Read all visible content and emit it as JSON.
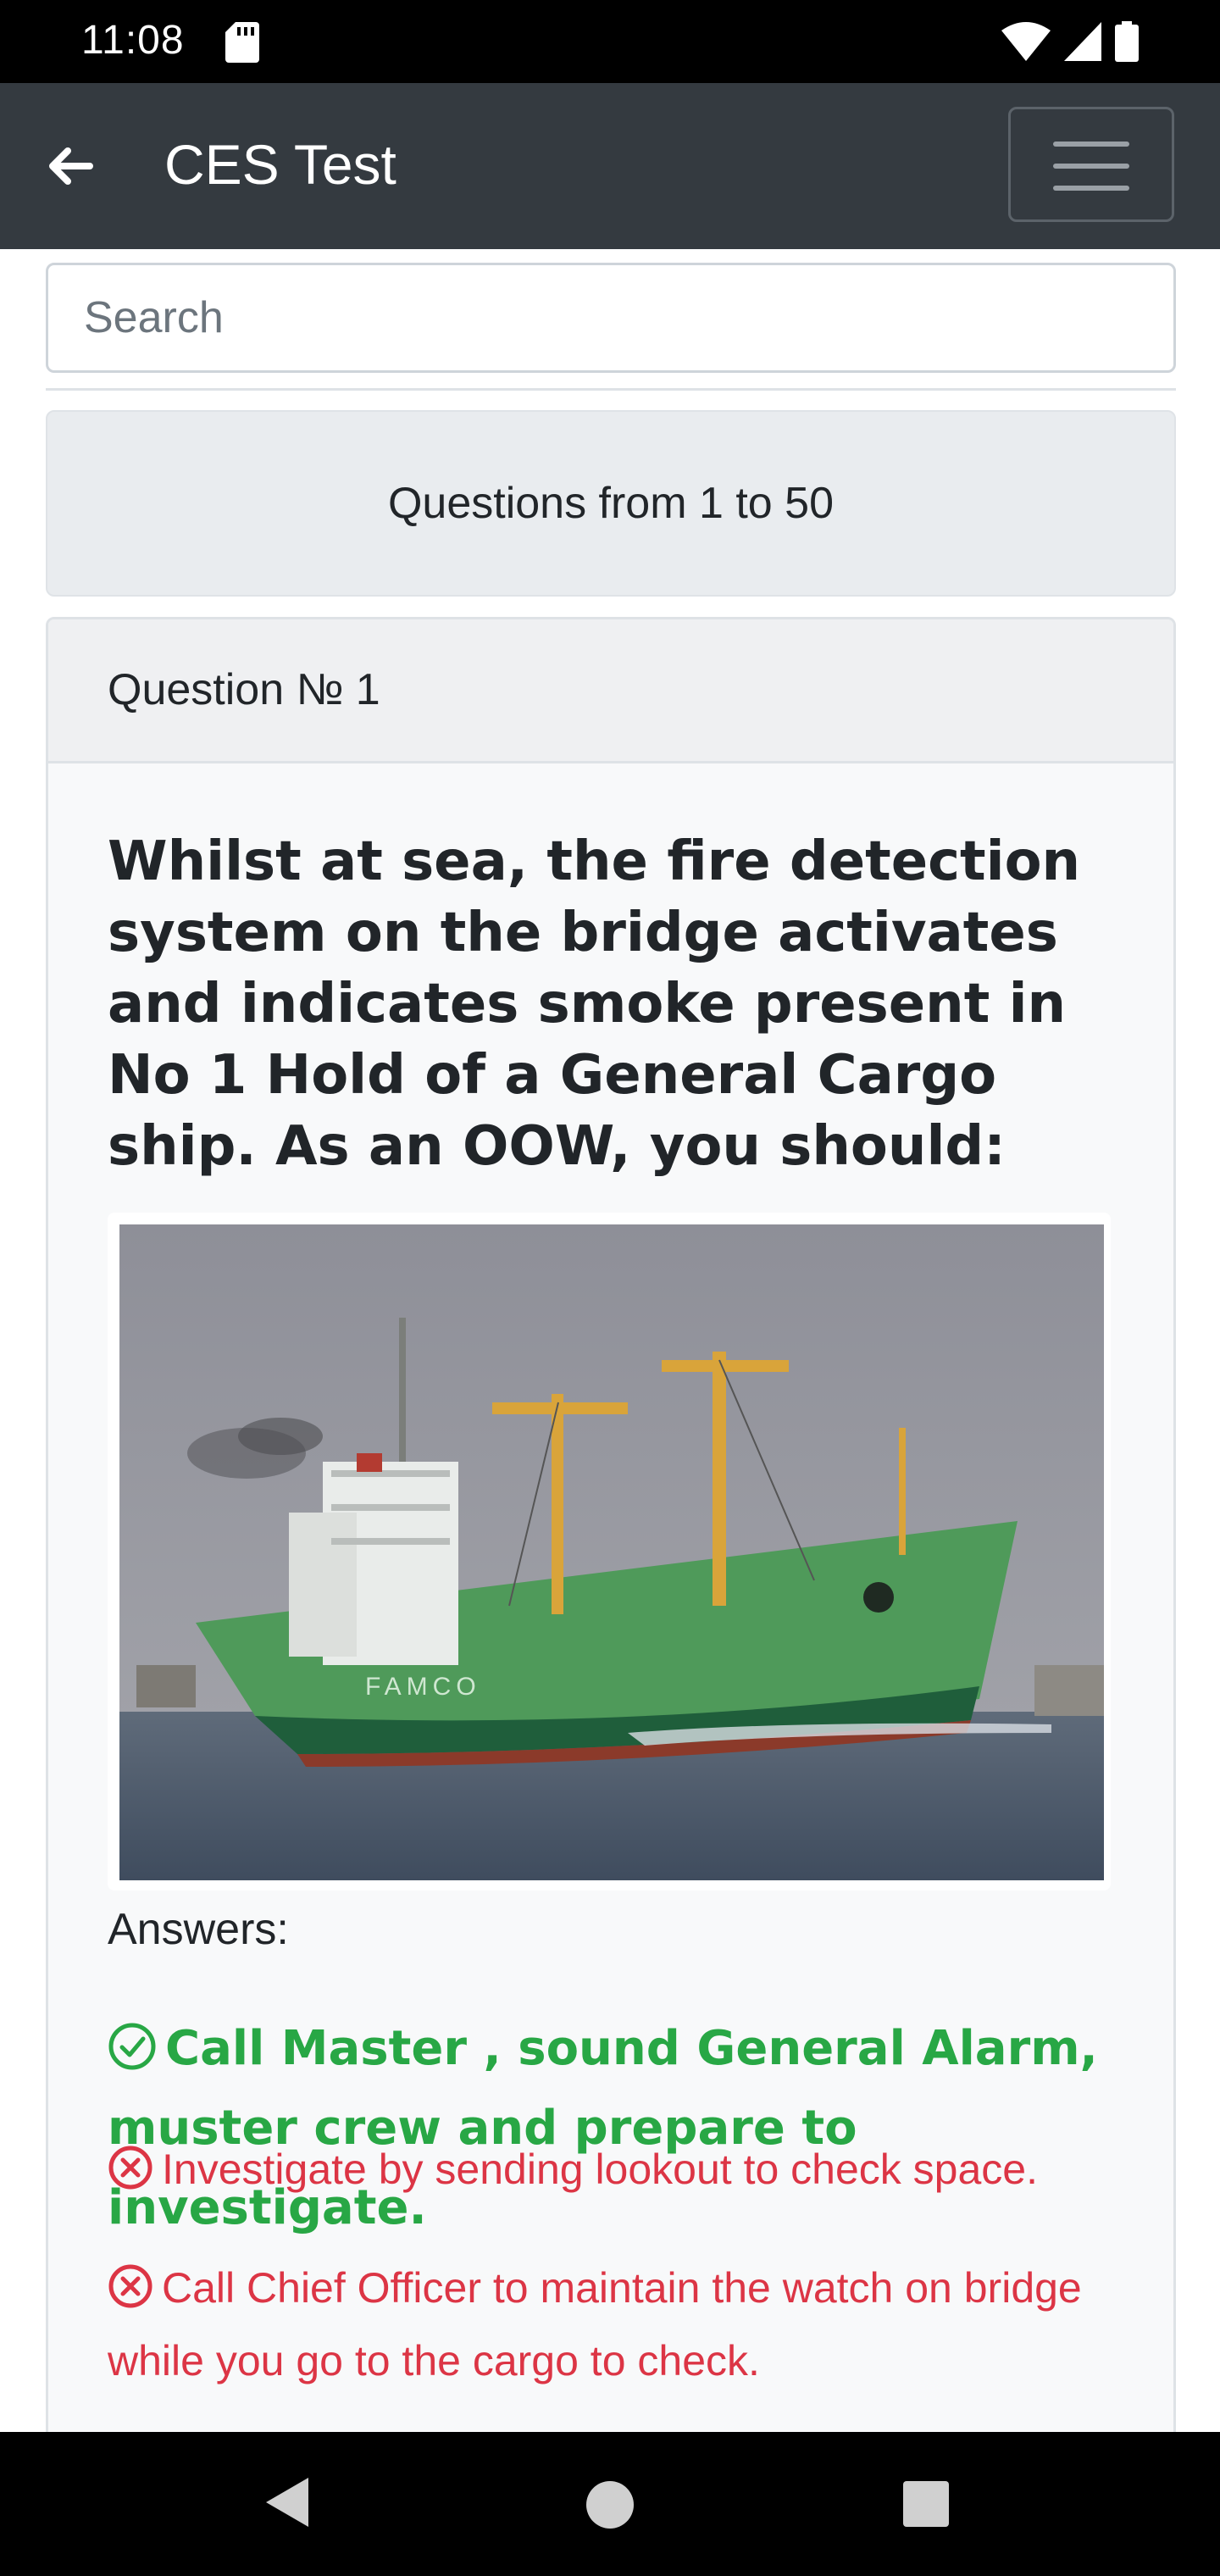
{
  "status_bar": {
    "time": "11:08"
  },
  "app_bar": {
    "title": "CES Test"
  },
  "search": {
    "placeholder": "Search",
    "value": ""
  },
  "range_label": "Questions from 1 to 50",
  "question": {
    "number_label": "Question № 1",
    "text": "Whilst at sea, the fire detection system on the bridge activates and indicates smoke present in No 1 Hold of a General Cargo ship. As an OOW, you should:",
    "image_hull_text": "FAMCO",
    "answers_label": "Answers:",
    "answers": [
      {
        "text": "Call Master , sound General Alarm, muster crew and prepare to investigate.",
        "status": "correct"
      },
      {
        "text": "Investigate by sending lookout to check space.",
        "status": "wrong"
      },
      {
        "text": "Call Chief Officer to maintain the watch on bridge while you go to the cargo to check.",
        "status": "wrong"
      }
    ]
  },
  "colors": {
    "app_bar": "#343a40",
    "correct": "#28a745",
    "wrong": "#dc3545"
  },
  "icons": {
    "back": "arrow-left-icon",
    "menu": "hamburger-menu-icon",
    "correct": "check-circle-icon",
    "wrong": "x-circle-icon"
  }
}
